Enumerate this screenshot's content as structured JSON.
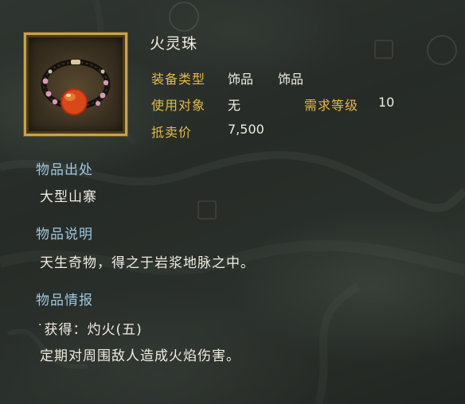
{
  "item": {
    "name": "火灵珠",
    "icon": "fire-bead-bracelet-icon"
  },
  "stats": {
    "equip_type_label": "装备类型",
    "equip_type_value_1": "饰品",
    "equip_type_value_2": "饰品",
    "target_label": "使用对象",
    "target_value": "无",
    "level_req_label": "需求等级",
    "level_req_value": "10",
    "sell_price_label": "抵卖价",
    "sell_price_value": "7,500"
  },
  "sections": {
    "origin": {
      "title": "物品出处",
      "text": "大型山寨"
    },
    "description": {
      "title": "物品说明",
      "text": "天生奇物，得之于岩浆地脉之中。"
    },
    "info": {
      "title": "物品情报",
      "line1": "˙获得：灼火(五)",
      "line2": "定期对周围敌人造成火焰伤害。"
    }
  },
  "colors": {
    "label_gold": "#e2b94b",
    "section_blue": "#9fc7e3",
    "text_white": "#f0ece0",
    "frame_gold": "#c9a24a"
  }
}
